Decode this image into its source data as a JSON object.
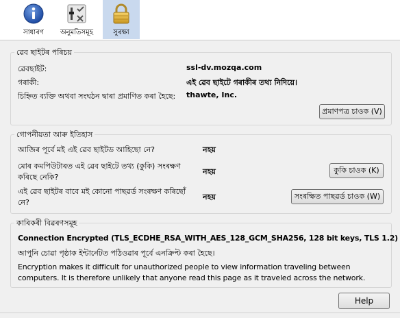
{
  "toolbar": {
    "items": [
      {
        "label": "সাধাৰণ",
        "icon": "info-icon",
        "selected": false
      },
      {
        "label": "অনুমতিসমূহ",
        "icon": "permissions-icon",
        "selected": false
      },
      {
        "label": "সুৰক্ষা",
        "icon": "lock-icon",
        "selected": true
      }
    ]
  },
  "identity": {
    "legend": "ৱেব ছাইটৰ পৰিচয়",
    "website_label": "ৱেবছাইট:",
    "website_value": "ssl-dv.mozqa.com",
    "owner_label": "গৰাকী:",
    "owner_value": "এই ৱেব ছাইটে গৰাকীৰ তথ্য নিদিয়ে।",
    "verifier_label": "চিহ্নিত ব্যক্তি অথবা সংঘঠন দ্বাৰা প্ৰমাণিত কৰা হৈছে:",
    "verifier_value": "thawte, Inc.",
    "view_cert_button": "প্ৰমাণপত্ৰ চাওক (V)"
  },
  "privacy": {
    "legend": "গোপনীয়তা আৰু ইতিহাস",
    "visited_question": "আজিৰ পূৰ্বে মই এই ৱেব ছাইটড আহিছো নে?",
    "visited_answer": "নহয়",
    "cookies_question_line1": "মোৰ কমপিউটাৰত এই ৱেব ছাইটে তথ্য (কুকি) সংৰক্ষণ",
    "cookies_question_line2": "কৰিছে নেকি?",
    "cookies_answer": "নহয়",
    "view_cookies_button": "কুকি চাওক (K)",
    "passwords_question_line1": "এই ৱেব ছাইটৰ বাবে মই কোনো পাছৱৰ্ড সংৰক্ষণ কৰিছোঁ",
    "passwords_question_line2": "নে?",
    "passwords_answer": "নহয়",
    "view_passwords_button": "সংৰক্ষিত পাছৱৰ্ড চাওক (W)"
  },
  "technical": {
    "legend": "কাৰিকৰী বিৱৰণসমূহ",
    "connection": "Connection Encrypted (TLS_ECDHE_RSA_WITH_AES_128_GCM_SHA256, 128 bit keys, TLS 1.2)",
    "encrypted_note": "আপুনি চোৱা পৃষ্ঠাক ইন্টাৰ্নেটত পঠিওৱাৰ পূৰ্বে এনক্ৰিপ্ট কৰা হৈছে।",
    "explanation_line1": "Encryption makes it difficult for unauthorized people to view information traveling between",
    "explanation_line2": "computers. It is therefore unlikely that anyone read this page as it traveled across the network."
  },
  "help_button": "Help"
}
